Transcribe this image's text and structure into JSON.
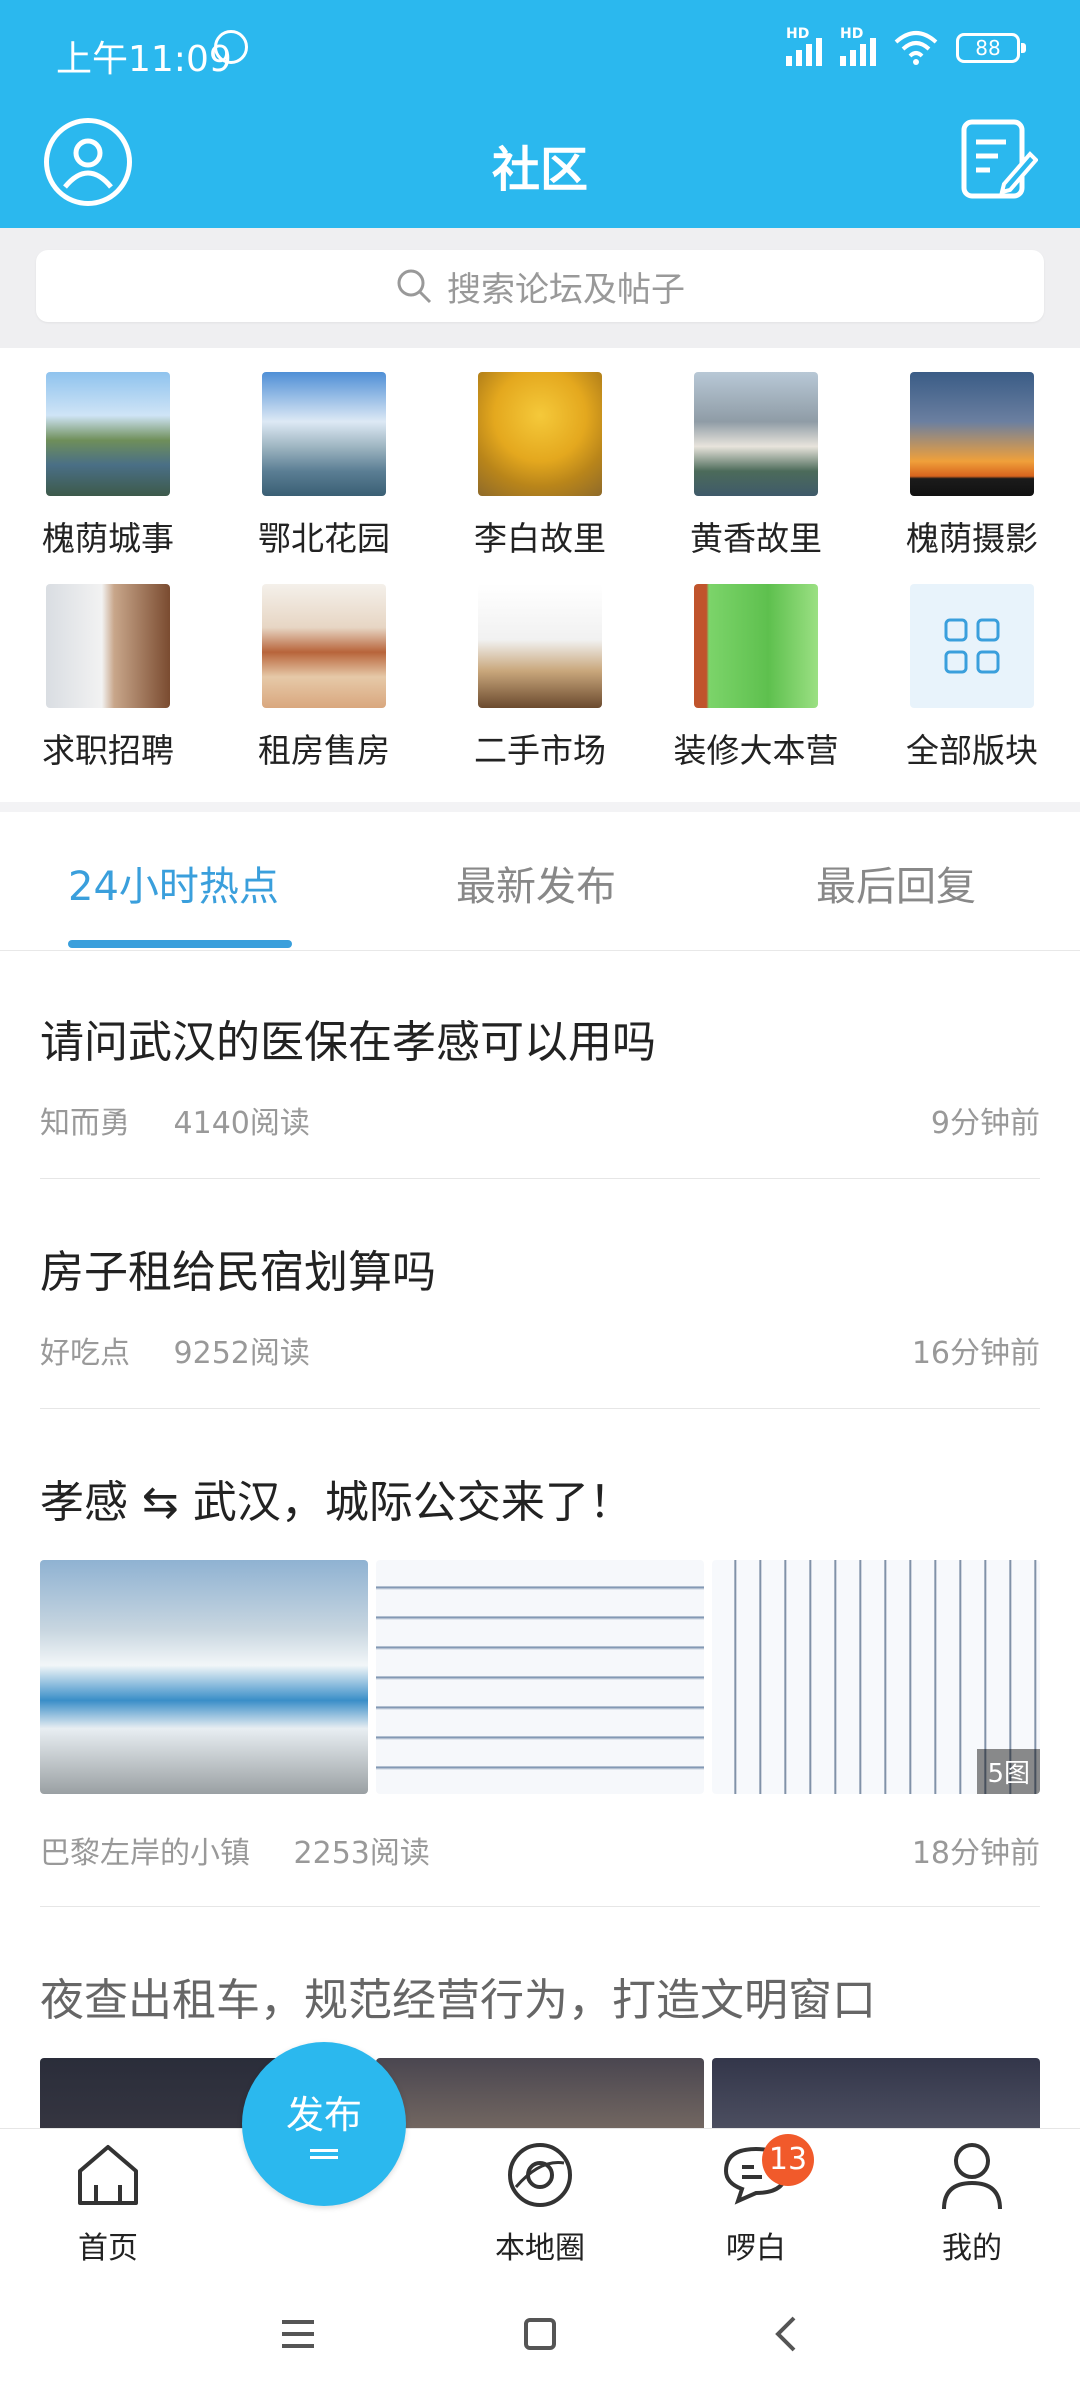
{
  "status_bar": {
    "time": "上午11:09",
    "battery": "88",
    "network1": "HD",
    "network2": "HD"
  },
  "header": {
    "title": "社区"
  },
  "search": {
    "placeholder": "搜索论坛及帖子"
  },
  "categories": [
    {
      "label": "槐荫城事"
    },
    {
      "label": "鄂北花园"
    },
    {
      "label": "李白故里"
    },
    {
      "label": "黄香故里"
    },
    {
      "label": "槐荫摄影"
    },
    {
      "label": "求职招聘"
    },
    {
      "label": "租房售房"
    },
    {
      "label": "二手市场"
    },
    {
      "label": "装修大本营"
    },
    {
      "label": "全部版块"
    }
  ],
  "tabs": [
    {
      "label": "24小时热点",
      "active": true
    },
    {
      "label": "最新发布"
    },
    {
      "label": "最后回复"
    }
  ],
  "posts": [
    {
      "title": "请问武汉的医保在孝感可以用吗",
      "author": "知而勇",
      "reads": "4140阅读",
      "time": "9分钟前"
    },
    {
      "title": "房子租给民宿划算吗",
      "author": "好吃点",
      "reads": "9252阅读",
      "time": "16分钟前"
    },
    {
      "title": "孝感 ⇆ 武汉，城际公交来了！",
      "author": "巴黎左岸的小镇",
      "reads": "2253阅读",
      "time": "18分钟前",
      "image_count": "5图"
    },
    {
      "title": "夜查出租车，规范经营行为，打造文明窗口"
    }
  ],
  "bottom_nav": {
    "home": "首页",
    "publish": "发布",
    "local": "本地圈",
    "chat": "啰白",
    "chat_badge": "13",
    "me": "我的"
  },
  "colors": {
    "brand": "#2bb8ee",
    "tab_active": "#3a9fdc",
    "badge": "#f15a2b"
  }
}
